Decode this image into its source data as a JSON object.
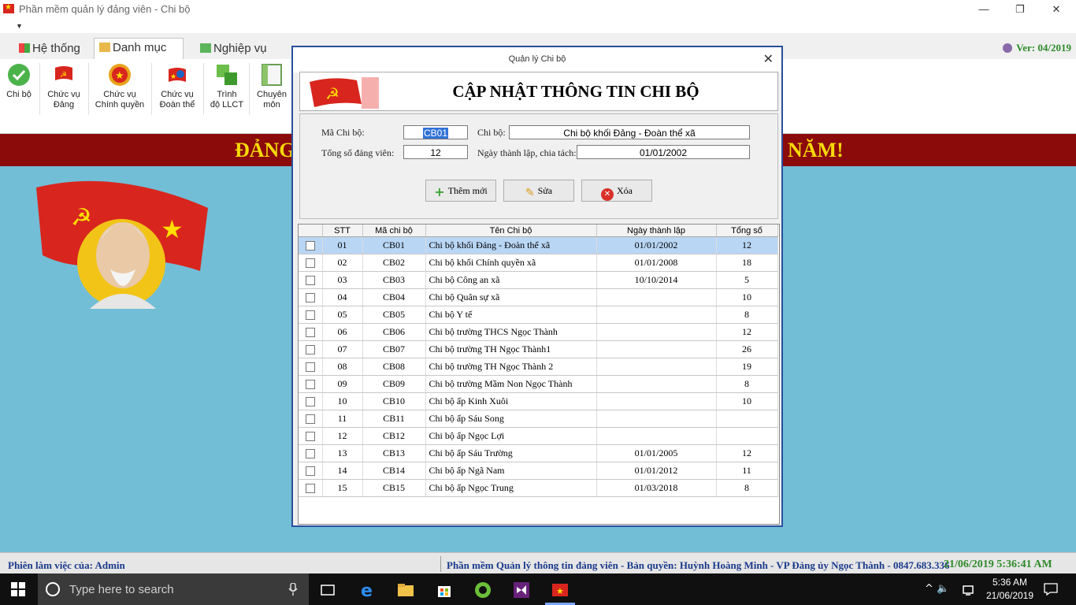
{
  "window": {
    "title": "Phần mềm quản lý đảng viên - Chi bộ",
    "minimize": "—",
    "restore": "❐",
    "close": "✕"
  },
  "ribbon": {
    "qat": "▼",
    "tabs": [
      {
        "label": "Hệ thống",
        "active": false
      },
      {
        "label": "Danh mục",
        "active": true
      },
      {
        "label": "Nghiệp vụ",
        "active": false
      }
    ],
    "version": "Ver: 04/2019",
    "buttons": [
      {
        "label1": "Chi bộ",
        "label2": ""
      },
      {
        "label1": "Chức vụ",
        "label2": "Đảng"
      },
      {
        "label1": "Chức vụ",
        "label2": "Chính quyền"
      },
      {
        "label1": "Chức vụ",
        "label2": "Đoàn thể"
      },
      {
        "label1": "Trình",
        "label2": "độ LLCT"
      },
      {
        "label1": "Chuyên",
        "label2": "môn"
      }
    ]
  },
  "banner": {
    "left": "ĐẢNG",
    "right": "NĂM!"
  },
  "dialog": {
    "title": "Quản lý Chi bộ",
    "close": "✕",
    "heading": "CẬP NHẬT THÔNG TIN CHI BỘ",
    "form": {
      "ma_label": "Mã Chi bộ:",
      "ma_value": "CB01",
      "chibo_label": "Chi bộ:",
      "chibo_value": "Chi bộ khối Đảng - Đoàn thể xã",
      "tong_label": "Tổng số đảng viên:",
      "tong_value": "12",
      "ngay_label": "Ngày thành lập, chia tách:",
      "ngay_value": "01/01/2002"
    },
    "buttons": {
      "add": "Thêm mới",
      "edit": "Sửa",
      "delete": "Xóa"
    },
    "grid": {
      "headers": [
        "",
        "STT",
        "Mã chi bộ",
        "Tên Chi bộ",
        "Ngày thành lập",
        "Tổng số"
      ],
      "rows": [
        {
          "stt": "01",
          "ma": "CB01",
          "ten": "Chi bộ khối Đảng - Đoàn thể xã",
          "ngay": "01/01/2002",
          "tong": "12",
          "selected": true
        },
        {
          "stt": "02",
          "ma": "CB02",
          "ten": "Chi bộ khối Chính quyền xã",
          "ngay": "01/01/2008",
          "tong": "18"
        },
        {
          "stt": "03",
          "ma": "CB03",
          "ten": "Chi bộ Công an xã",
          "ngay": "10/10/2014",
          "tong": "5"
        },
        {
          "stt": "04",
          "ma": "CB04",
          "ten": "Chi bộ Quân sự xã",
          "ngay": "",
          "tong": "10"
        },
        {
          "stt": "05",
          "ma": "CB05",
          "ten": "Chi bộ Y tế",
          "ngay": "",
          "tong": "8"
        },
        {
          "stt": "06",
          "ma": "CB06",
          "ten": "Chi bộ trường THCS Ngọc Thành",
          "ngay": "",
          "tong": "12"
        },
        {
          "stt": "07",
          "ma": "CB07",
          "ten": "Chi bộ trường TH Ngọc Thành1",
          "ngay": "",
          "tong": "26"
        },
        {
          "stt": "08",
          "ma": "CB08",
          "ten": "Chi bộ trường TH Ngọc Thành 2",
          "ngay": "",
          "tong": "19"
        },
        {
          "stt": "09",
          "ma": "CB09",
          "ten": "Chi bộ trường Mầm Non Ngọc Thành",
          "ngay": "",
          "tong": "8"
        },
        {
          "stt": "10",
          "ma": "CB10",
          "ten": "Chi bộ ấp Kinh Xuôi",
          "ngay": "",
          "tong": "10"
        },
        {
          "stt": "11",
          "ma": "CB11",
          "ten": "Chi bộ ấp Sáu Song",
          "ngay": "",
          "tong": ""
        },
        {
          "stt": "12",
          "ma": "CB12",
          "ten": "Chi bộ ấp Ngọc Lợi",
          "ngay": "",
          "tong": ""
        },
        {
          "stt": "13",
          "ma": "CB13",
          "ten": "Chi bộ ấp Sáu Trường",
          "ngay": "01/01/2005",
          "tong": "12"
        },
        {
          "stt": "14",
          "ma": "CB14",
          "ten": "Chi bộ ấp Ngã Nam",
          "ngay": "01/01/2012",
          "tong": "11"
        },
        {
          "stt": "15",
          "ma": "CB15",
          "ten": "Chi bộ ấp Ngọc Trung",
          "ngay": "01/03/2018",
          "tong": "8"
        }
      ]
    }
  },
  "status": {
    "session": "Phiên làm việc của: Admin",
    "copyright": "Phần mềm Quản lý thông tin đảng viên - Bản quyền: Huỳnh Hoàng Minh - VP Đảng ủy Ngọc Thành - 0847.683.336",
    "datetime": "21/06/2019 5:36:41 AM"
  },
  "taskbar": {
    "search_placeholder": "Type here to search",
    "time": "5:36 AM",
    "date": "21/06/2019",
    "tray": "^  🔈"
  },
  "colors": {
    "banner_bg": "#8b0a0a",
    "banner_text": "#f5d90a",
    "main_bg": "#72bed6",
    "dialog_border": "#2a4f9c",
    "selected_row": "#b9d6f5"
  }
}
